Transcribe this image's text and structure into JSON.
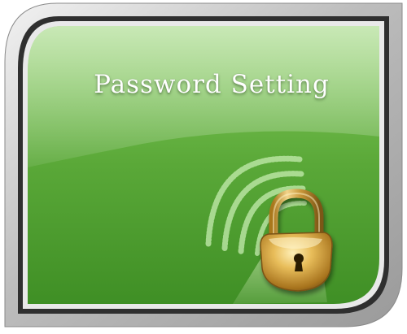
{
  "card": {
    "title": "Password Setting",
    "icon": "padlock-icon",
    "signal_icon": "wireless-signal-icon",
    "colors": {
      "frame_silver": "#c9c9c9",
      "frame_dark": "#3a3a3a",
      "panel_green_light": "#7cc555",
      "panel_green_dark": "#4a9a2c",
      "lock_gold": "#c99a3a"
    }
  }
}
